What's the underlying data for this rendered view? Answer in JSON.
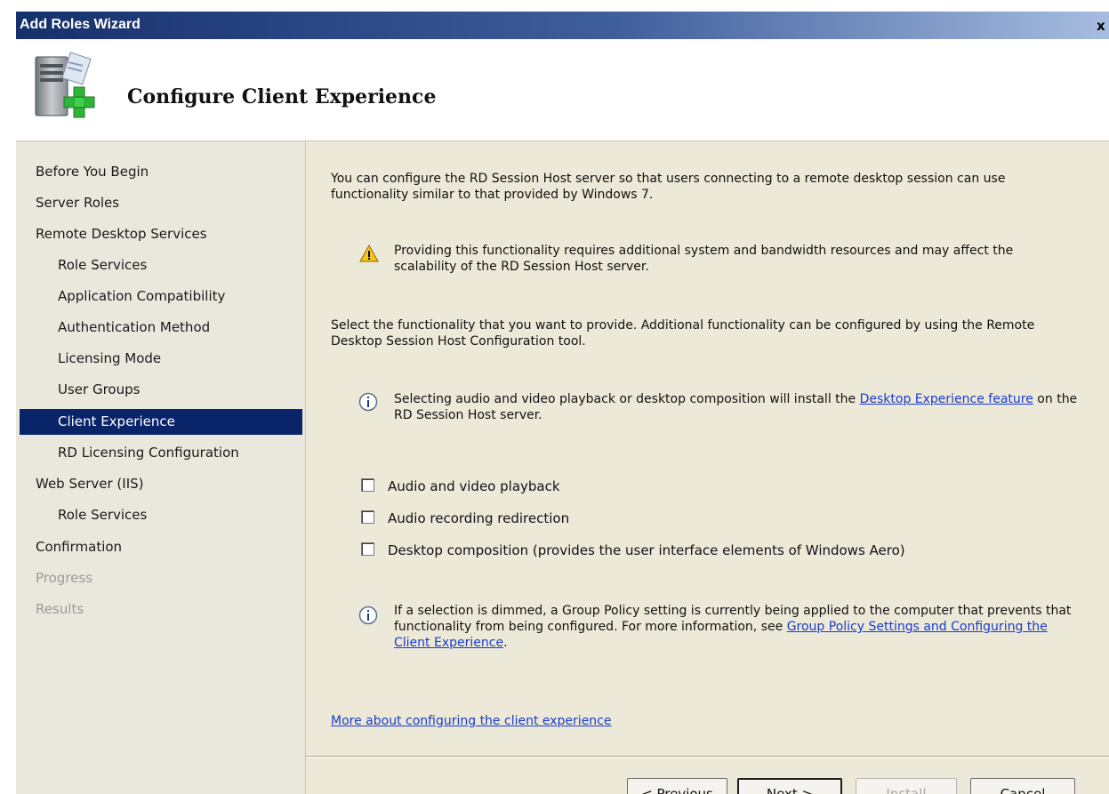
{
  "window": {
    "title": "Add Roles Wizard",
    "close_glyph": "x"
  },
  "header": {
    "title": "Configure Client Experience",
    "icon": "server-add-icon"
  },
  "sidebar": {
    "items": [
      {
        "label": "Before You Begin",
        "state": "normal"
      },
      {
        "label": "Server Roles",
        "state": "normal"
      },
      {
        "label": "Remote Desktop Services",
        "state": "normal"
      },
      {
        "label": "Role Services",
        "state": "normal"
      },
      {
        "label": "Application Compatibility",
        "state": "normal"
      },
      {
        "label": "Authentication Method",
        "state": "normal"
      },
      {
        "label": "Licensing Mode",
        "state": "normal"
      },
      {
        "label": "User Groups",
        "state": "normal"
      },
      {
        "label": "Client Experience",
        "state": "active"
      },
      {
        "label": "RD Licensing Configuration",
        "state": "normal"
      },
      {
        "label": "Web Server (IIS)",
        "state": "normal"
      },
      {
        "label": "Role Services",
        "state": "normal"
      },
      {
        "label": "Confirmation",
        "state": "normal"
      },
      {
        "label": "Progress",
        "state": "disabled"
      },
      {
        "label": "Results",
        "state": "disabled"
      }
    ]
  },
  "content": {
    "intro": "You can configure the RD Session Host server so that users connecting to a remote desktop session can use functionality similar to that provided by Windows 7.",
    "warning": "Providing this functionality requires additional system and bandwidth resources and may affect the scalability of the RD Session Host server.",
    "select_text": "Select the functionality that you want to provide. Additional functionality can be configured by using the Remote Desktop Session Host Configuration tool.",
    "info1_before": "Selecting audio and video playback or desktop composition will install the ",
    "info1_link": "Desktop Experience feature",
    "info1_after": " on the RD Session Host server.",
    "checkboxes": [
      {
        "label": "Audio and video playback",
        "checked": false
      },
      {
        "label": "Audio recording redirection",
        "checked": false
      },
      {
        "label": "Desktop composition (provides the user interface elements of Windows Aero)",
        "checked": false
      }
    ],
    "info2_before": "If a selection is dimmed, a Group Policy setting is currently being applied to the computer that prevents that functionality from being configured. For more information, see ",
    "info2_link": "Group Policy Settings and Configuring the Client Experience",
    "info2_after": ".",
    "more_link": "More about configuring the client experience"
  },
  "buttons": {
    "previous": "< Previous",
    "next": "Next >",
    "install": "Install",
    "cancel": "Cancel"
  }
}
